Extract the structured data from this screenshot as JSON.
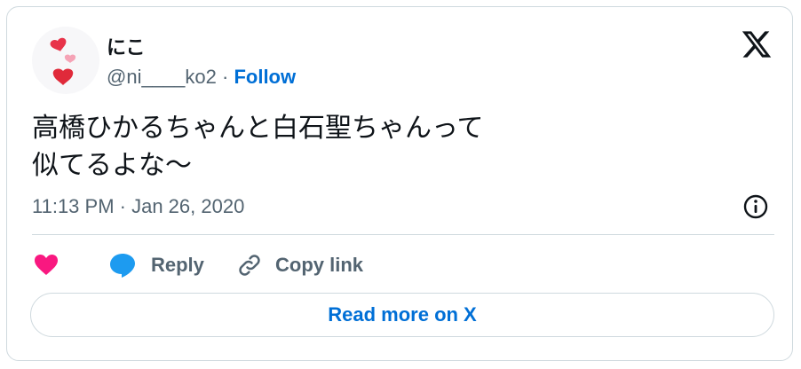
{
  "author": {
    "display_name": "にこ",
    "handle": "@ni____ko2",
    "separator": "·",
    "follow_label": "Follow"
  },
  "tweet": {
    "lines": [
      "高橋ひかるちゃんと白石聖ちゃんって",
      "似てるよな〜"
    ],
    "timestamp": "11:13 PM · Jan 26, 2020"
  },
  "actions": {
    "reply_label": "Reply",
    "copy_link_label": "Copy link"
  },
  "read_more_label": "Read more on X",
  "icons": {
    "brand": "x-logo-icon",
    "info": "info-icon",
    "like": "heart-icon",
    "reply": "speech-bubble-icon",
    "copy": "link-icon"
  },
  "colors": {
    "link": "#006fd6",
    "secondary_text": "#536471",
    "heart": "#f91880",
    "reply_bubble": "#1d9bf0",
    "border": "#cfd9de"
  }
}
